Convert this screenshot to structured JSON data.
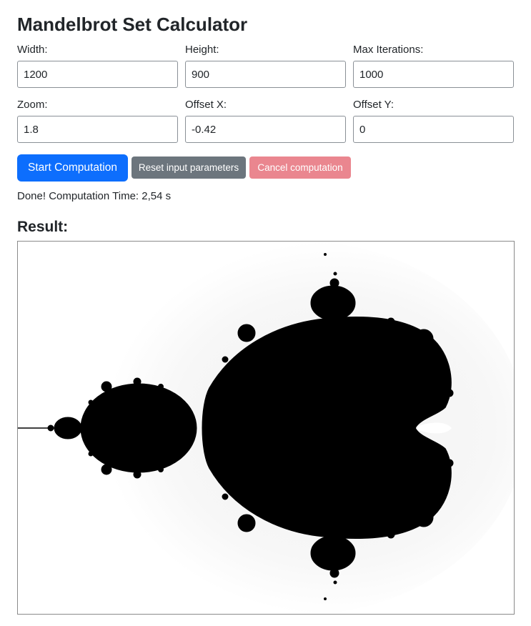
{
  "header": {
    "title": "Mandelbrot Set Calculator"
  },
  "form": {
    "width": {
      "label": "Width:",
      "value": "1200"
    },
    "height": {
      "label": "Height:",
      "value": "900"
    },
    "max_iterations": {
      "label": "Max Iterations:",
      "value": "1000"
    },
    "zoom": {
      "label": "Zoom:",
      "value": "1.8"
    },
    "offset_x": {
      "label": "Offset X:",
      "value": "-0.42"
    },
    "offset_y": {
      "label": "Offset Y:",
      "value": "0"
    }
  },
  "buttons": {
    "start_label": "Start Computation",
    "reset_label": "Reset input parameters",
    "cancel_label": "Cancel computation"
  },
  "status": {
    "text": "Done! Computation Time: 2,54 s"
  },
  "result": {
    "heading": "Result:"
  },
  "colors": {
    "primary": "#0d6efd",
    "secondary": "#6c757d",
    "danger_disabled": "#ea868f",
    "set_fill": "#000000",
    "background": "#ffffff"
  }
}
